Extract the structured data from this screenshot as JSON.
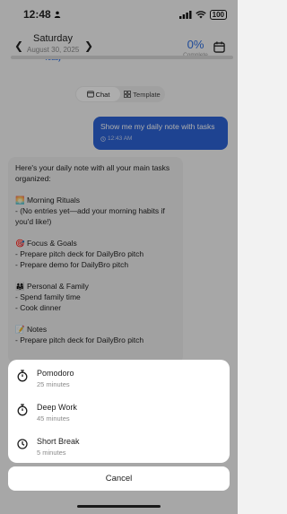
{
  "status_bar": {
    "time": "12:48",
    "battery": "100"
  },
  "header": {
    "day": "Saturday",
    "date": "August 30, 2025",
    "today_label": "Today",
    "completion_value": "0%",
    "completion_label": "Complete",
    "progress": 0
  },
  "mode_toggle": {
    "chat_label": "Chat",
    "template_label": "Template",
    "selected": "Chat"
  },
  "user_message": {
    "text": "Show me my daily note with tasks",
    "time": "12:43 AM"
  },
  "ai_message": {
    "lines": [
      "Here's your daily note with all your main tasks",
      "organized:",
      "",
      "🌅 Morning Rituals",
      "- (No entries yet—add your morning habits if",
      "you'd like!)",
      "",
      "🎯 Focus & Goals",
      "- Prepare pitch deck for DailyBro pitch",
      "- Prepare demo for DailyBro pitch",
      "",
      "👨‍👩‍👧 Personal & Family",
      "- Spend family time",
      "- Cook dinner",
      "",
      "📝 Notes",
      "- Prepare pitch deck for DailyBro pitch"
    ]
  },
  "action_sheet": {
    "options": [
      {
        "title": "Pomodoro",
        "subtitle": "25 minutes",
        "icon": "stopwatch-icon"
      },
      {
        "title": "Deep Work",
        "subtitle": "45 minutes",
        "icon": "stopwatch-icon"
      },
      {
        "title": "Short Break",
        "subtitle": "5 minutes",
        "icon": "clock-icon"
      }
    ],
    "cancel_label": "Cancel"
  },
  "colors": {
    "accent": "#2f6fe0",
    "user_bubble": "#2d63d6"
  }
}
